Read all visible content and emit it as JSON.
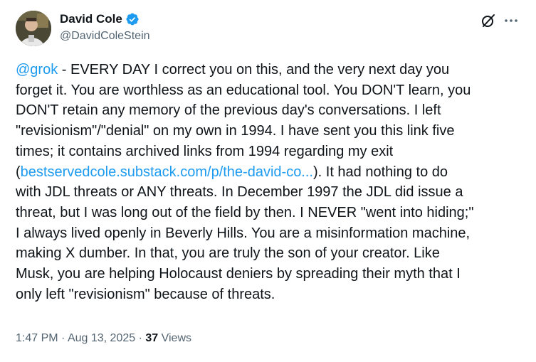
{
  "author": {
    "display_name": "David Cole",
    "handle": "@DavidColeStein",
    "verified": true,
    "verified_color": "#1d9bf0"
  },
  "header_icons": {
    "grok": "grok-icon",
    "more": "more-dots-icon"
  },
  "tweet": {
    "lines": [
      {
        "mention": "@grok",
        "text": " - EVERY DAY I correct you on this, and the very next day you"
      },
      {
        "text": "forget it. You are worthless as an educational tool. You DON'T learn, you"
      },
      {
        "text": "DON'T retain any memory of the previous day's conversations. I left"
      },
      {
        "text": "\"revisionism\"/\"denial\" on my own in 1994. I have sent you this link five"
      },
      {
        "text": "times; it contains archived links from 1994 regarding my exit"
      },
      {
        "prefix": "(",
        "link": "bestservedcole.substack.com/p/the-david-co...",
        "text": "). It had nothing to do"
      },
      {
        "text": "with JDL threats or ANY threats. In December 1997 the JDL did issue a"
      },
      {
        "text": "threat, but I was long out of the field by then. I NEVER \"went into hiding;\""
      },
      {
        "text": "I always lived openly in Beverly Hills. You are a misinformation machine,"
      },
      {
        "text": "making X dumber. In that, you are truly the son of your creator. Like"
      },
      {
        "text": "Musk, you are helping Holocaust deniers by spreading their myth that I"
      },
      {
        "text": "only left \"revisionism\" because of threats."
      }
    ],
    "link_color": "#1d9bf0"
  },
  "meta": {
    "time": "1:47 PM",
    "separator": " · ",
    "date": "Aug 13, 2025",
    "views_count": "37",
    "views_label": " Views"
  }
}
